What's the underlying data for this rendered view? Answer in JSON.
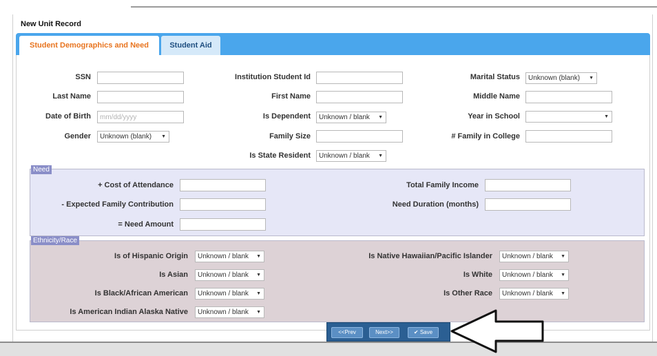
{
  "window": {
    "title": "New Unit Record"
  },
  "tabs": [
    {
      "label": "Student Demographics and Need",
      "active": true
    },
    {
      "label": "Student Aid",
      "active": false
    }
  ],
  "demographics": {
    "ssn": {
      "label": "SSN",
      "value": ""
    },
    "institution_student_id": {
      "label": "Institution Student Id",
      "value": ""
    },
    "marital_status": {
      "label": "Marital Status",
      "value": "Unknown (blank)"
    },
    "last_name": {
      "label": "Last Name",
      "value": ""
    },
    "first_name": {
      "label": "First Name",
      "value": ""
    },
    "middle_name": {
      "label": "Middle Name",
      "value": ""
    },
    "date_of_birth": {
      "label": "Date of Birth",
      "value": "",
      "placeholder": "mm/dd/yyyy"
    },
    "is_dependent": {
      "label": "Is Dependent",
      "value": "Unknown / blank"
    },
    "year_in_school": {
      "label": "Year in School",
      "value": ""
    },
    "gender": {
      "label": "Gender",
      "value": "Unknown (blank)"
    },
    "family_size": {
      "label": "Family Size",
      "value": ""
    },
    "family_in_college": {
      "label": "# Family in College",
      "value": ""
    },
    "is_state_resident": {
      "label": "Is State Resident",
      "value": "Unknown / blank"
    }
  },
  "need": {
    "title": "Need",
    "cost_of_attendance": {
      "label": "+ Cost of Attendance",
      "value": ""
    },
    "expected_family_contribution": {
      "label": "- Expected Family Contribution",
      "value": ""
    },
    "need_amount": {
      "label": "= Need Amount",
      "value": ""
    },
    "total_family_income": {
      "label": "Total Family Income",
      "value": ""
    },
    "need_duration": {
      "label": "Need Duration (months)",
      "value": ""
    }
  },
  "ethnicity": {
    "title": "Ethnicity/Race",
    "hispanic": {
      "label": "Is of Hispanic Origin",
      "value": "Unknown / blank"
    },
    "asian": {
      "label": "Is Asian",
      "value": "Unknown / blank"
    },
    "black": {
      "label": "Is Black/African American",
      "value": "Unknown / blank"
    },
    "american_indian": {
      "label": "Is American Indian Alaska Native",
      "value": "Unknown / blank"
    },
    "native_hawaiian": {
      "label": "Is Native Hawaiian/Pacific Islander",
      "value": "Unknown / blank"
    },
    "white": {
      "label": "Is White",
      "value": "Unknown / blank"
    },
    "other_race": {
      "label": "Is Other Race",
      "value": "Unknown / blank"
    }
  },
  "buttons": {
    "prev": "<<Prev",
    "next": "Next>>",
    "save": "Save",
    "save_icon": "check-icon"
  },
  "colors": {
    "tab_bar": "#4aa6ec",
    "active_tab_text": "#e8741f",
    "need_panel": "#e6e7f7",
    "ethnicity_panel": "#ddd2d6",
    "button_bar": "#2b5f93"
  }
}
